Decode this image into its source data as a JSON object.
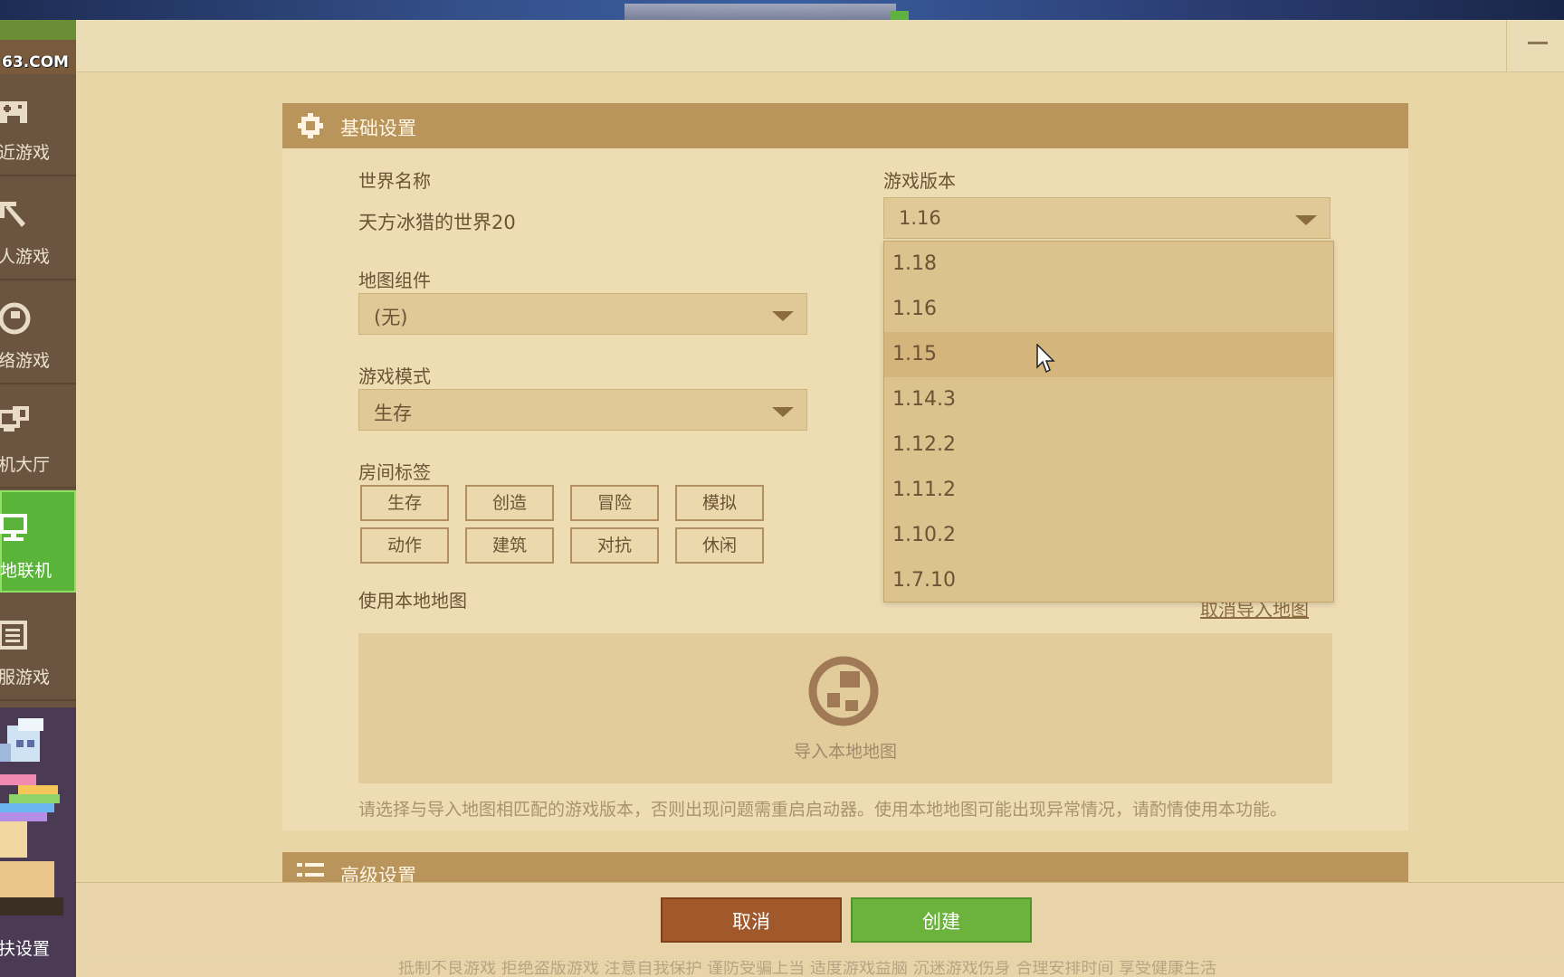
{
  "app": {
    "logo_text": "63.COM",
    "minimize_icon": "minimize-icon"
  },
  "sidebar": {
    "items": [
      {
        "label": "近游戏",
        "icon": "gamepad-icon"
      },
      {
        "label": "人游戏",
        "icon": "pickaxe-icon"
      },
      {
        "label": "络游戏",
        "icon": "globe-icon"
      },
      {
        "label": "机大厅",
        "icon": "monitor-icon"
      },
      {
        "label": "地联机",
        "icon": "local-network-icon",
        "active": true
      },
      {
        "label": "服游戏",
        "icon": "list-icon"
      }
    ],
    "bottom_label": "扶设置"
  },
  "basic": {
    "section_title": "基础设置",
    "world_name_label": "世界名称",
    "world_name_value": "天方冰猎的世界20",
    "map_component_label": "地图组件",
    "map_component_value": "(无)",
    "game_mode_label": "游戏模式",
    "game_mode_value": "生存",
    "room_tags_label": "房间标签",
    "tags": [
      "生存",
      "创造",
      "冒险",
      "模拟",
      "动作",
      "建筑",
      "对抗",
      "休闲"
    ],
    "local_map_label": "使用本地地图",
    "import_map_text": "导入本地地图",
    "cancel_import_link": "取消导入地图",
    "hint_text": "请选择与导入地图相匹配的游戏版本，否则出现问题需重启启动器。使用本地地图可能出现异常情况，请酌情使用本功能。",
    "version_label": "游戏版本",
    "version_value": "1.16",
    "version_options": [
      "1.18",
      "1.16",
      "1.15",
      "1.14.3",
      "1.12.2",
      "1.11.2",
      "1.10.2",
      "1.7.10"
    ],
    "hovered_option": "1.15"
  },
  "advanced": {
    "section_title": "高级设置"
  },
  "footer": {
    "cancel_label": "取消",
    "create_label": "创建",
    "disclaimer": "抵制不良游戏 拒绝盗版游戏 注意自我保护 谨防受骗上当 适度游戏益脑 沉迷游戏伤身 合理安排时间 享受健康生活"
  },
  "colors": {
    "accent_green": "#6bb33c",
    "cancel_brown": "#a1582a",
    "section_header": "#b9955c"
  }
}
